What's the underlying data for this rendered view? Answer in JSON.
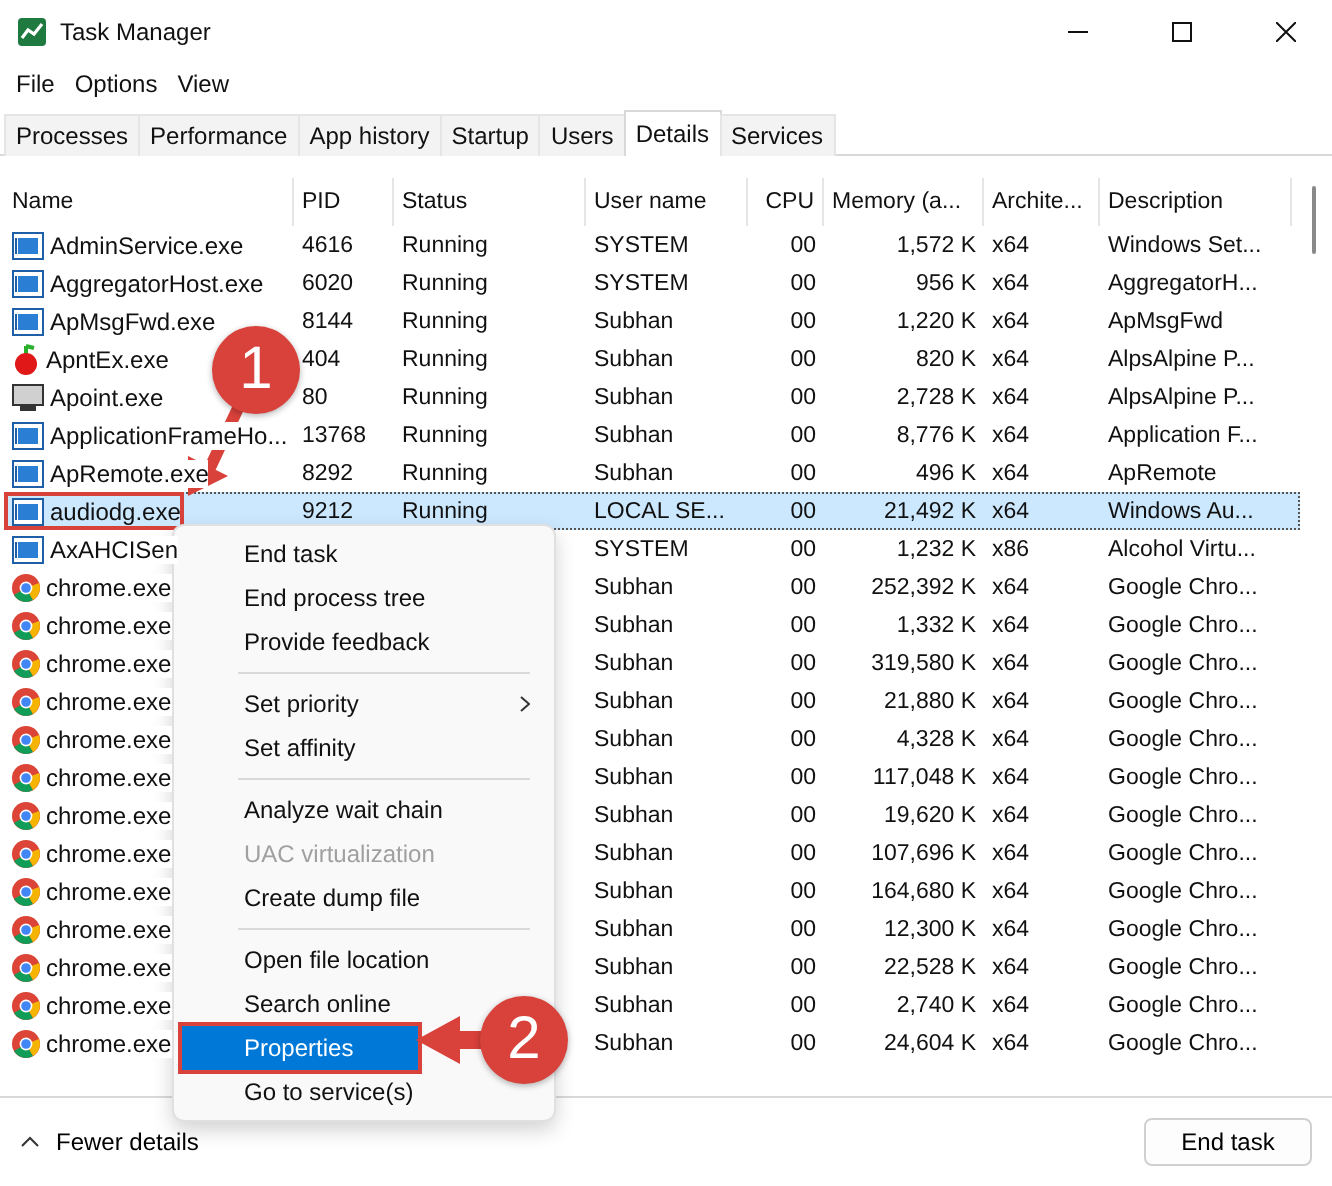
{
  "window": {
    "title": "Task Manager"
  },
  "menu": [
    "File",
    "Options",
    "View"
  ],
  "tabs": [
    {
      "label": "Processes",
      "selected": false
    },
    {
      "label": "Performance",
      "selected": false
    },
    {
      "label": "App history",
      "selected": false
    },
    {
      "label": "Startup",
      "selected": false
    },
    {
      "label": "Users",
      "selected": false
    },
    {
      "label": "Details",
      "selected": true
    },
    {
      "label": "Services",
      "selected": false
    }
  ],
  "columns": [
    "Name",
    "PID",
    "Status",
    "User name",
    "CPU",
    "Memory (a...",
    "Archite...",
    "Description"
  ],
  "rows": [
    {
      "kind": "exe",
      "name": "AdminService.exe",
      "pid": "4616",
      "status": "Running",
      "user": "SYSTEM",
      "cpu": "00",
      "memory": "1,572 K",
      "arch": "x64",
      "description": "Windows Set...",
      "selected": false
    },
    {
      "kind": "exe",
      "name": "AggregatorHost.exe",
      "pid": "6020",
      "status": "Running",
      "user": "SYSTEM",
      "cpu": "00",
      "memory": "956 K",
      "arch": "x64",
      "description": "AggregatorH...",
      "selected": false
    },
    {
      "kind": "exe",
      "name": "ApMsgFwd.exe",
      "pid": "8144",
      "status": "Running",
      "user": "Subhan",
      "cpu": "00",
      "memory": "1,220 K",
      "arch": "x64",
      "description": "ApMsgFwd",
      "selected": false
    },
    {
      "kind": "cherry",
      "name": "ApntEx.exe",
      "pid": "404",
      "status": "Running",
      "user": "Subhan",
      "cpu": "00",
      "memory": "820 K",
      "arch": "x64",
      "description": "AlpsAlpine P...",
      "selected": false
    },
    {
      "kind": "monitor",
      "name": "Apoint.exe",
      "pid": "80",
      "status": "Running",
      "user": "Subhan",
      "cpu": "00",
      "memory": "2,728 K",
      "arch": "x64",
      "description": "AlpsAlpine P...",
      "selected": false
    },
    {
      "kind": "exe",
      "name": "ApplicationFrameHo...",
      "pid": "13768",
      "status": "Running",
      "user": "Subhan",
      "cpu": "00",
      "memory": "8,776 K",
      "arch": "x64",
      "description": "Application F...",
      "selected": false
    },
    {
      "kind": "exe",
      "name": "ApRemote.exe",
      "pid": "8292",
      "status": "Running",
      "user": "Subhan",
      "cpu": "00",
      "memory": "496 K",
      "arch": "x64",
      "description": "ApRemote",
      "selected": false
    },
    {
      "kind": "exe",
      "name": "audiodg.exe",
      "pid": "9212",
      "status": "Running",
      "user": "LOCAL SE...",
      "cpu": "00",
      "memory": "21,492 K",
      "arch": "x64",
      "description": "Windows Au...",
      "selected": true
    },
    {
      "kind": "exe",
      "name": "AxAHCISen",
      "user": "SYSTEM",
      "cpu": "00",
      "memory": "1,232 K",
      "arch": "x86",
      "description": "Alcohol Virtu...",
      "selected": false
    },
    {
      "kind": "chrome",
      "name": "chrome.exe",
      "user": "Subhan",
      "cpu": "00",
      "memory": "252,392 K",
      "arch": "x64",
      "description": "Google Chro...",
      "selected": false
    },
    {
      "kind": "chrome",
      "name": "chrome.exe",
      "user": "Subhan",
      "cpu": "00",
      "memory": "1,332 K",
      "arch": "x64",
      "description": "Google Chro...",
      "selected": false
    },
    {
      "kind": "chrome",
      "name": "chrome.exe",
      "user": "Subhan",
      "cpu": "00",
      "memory": "319,580 K",
      "arch": "x64",
      "description": "Google Chro...",
      "selected": false
    },
    {
      "kind": "chrome",
      "name": "chrome.exe",
      "user": "Subhan",
      "cpu": "00",
      "memory": "21,880 K",
      "arch": "x64",
      "description": "Google Chro...",
      "selected": false
    },
    {
      "kind": "chrome",
      "name": "chrome.exe",
      "user": "Subhan",
      "cpu": "00",
      "memory": "4,328 K",
      "arch": "x64",
      "description": "Google Chro...",
      "selected": false
    },
    {
      "kind": "chrome",
      "name": "chrome.exe",
      "user": "Subhan",
      "cpu": "00",
      "memory": "117,048 K",
      "arch": "x64",
      "description": "Google Chro...",
      "selected": false
    },
    {
      "kind": "chrome",
      "name": "chrome.exe",
      "user": "Subhan",
      "cpu": "00",
      "memory": "19,620 K",
      "arch": "x64",
      "description": "Google Chro...",
      "selected": false
    },
    {
      "kind": "chrome",
      "name": "chrome.exe",
      "user": "Subhan",
      "cpu": "00",
      "memory": "107,696 K",
      "arch": "x64",
      "description": "Google Chro...",
      "selected": false
    },
    {
      "kind": "chrome",
      "name": "chrome.exe",
      "user": "Subhan",
      "cpu": "00",
      "memory": "164,680 K",
      "arch": "x64",
      "description": "Google Chro...",
      "selected": false
    },
    {
      "kind": "chrome",
      "name": "chrome.exe",
      "user": "Subhan",
      "cpu": "00",
      "memory": "12,300 K",
      "arch": "x64",
      "description": "Google Chro...",
      "selected": false
    },
    {
      "kind": "chrome",
      "name": "chrome.exe",
      "user": "Subhan",
      "cpu": "00",
      "memory": "22,528 K",
      "arch": "x64",
      "description": "Google Chro...",
      "selected": false
    },
    {
      "kind": "chrome",
      "name": "chrome.exe",
      "user": "Subhan",
      "cpu": "00",
      "memory": "2,740 K",
      "arch": "x64",
      "description": "Google Chro...",
      "selected": false
    },
    {
      "kind": "chrome",
      "name": "chrome.exe",
      "user": "Subhan",
      "cpu": "00",
      "memory": "24,604 K",
      "arch": "x64",
      "description": "Google Chro...",
      "selected": false
    }
  ],
  "context_menu": [
    {
      "kind": "item",
      "label": "End task",
      "disabled": false,
      "selected": false
    },
    {
      "kind": "item",
      "label": "End process tree",
      "disabled": false,
      "selected": false
    },
    {
      "kind": "item",
      "label": "Provide feedback",
      "disabled": false,
      "selected": false
    },
    {
      "kind": "separator"
    },
    {
      "kind": "submenu",
      "label": "Set priority",
      "disabled": false,
      "selected": false
    },
    {
      "kind": "item",
      "label": "Set affinity",
      "disabled": false,
      "selected": false
    },
    {
      "kind": "separator"
    },
    {
      "kind": "item",
      "label": "Analyze wait chain",
      "disabled": false,
      "selected": false
    },
    {
      "kind": "item",
      "label": "UAC virtualization",
      "disabled": true,
      "selected": false
    },
    {
      "kind": "item",
      "label": "Create dump file",
      "disabled": false,
      "selected": false
    },
    {
      "kind": "separator"
    },
    {
      "kind": "item",
      "label": "Open file location",
      "disabled": false,
      "selected": false
    },
    {
      "kind": "item",
      "label": "Search online",
      "disabled": false,
      "selected": false
    },
    {
      "kind": "item",
      "label": "Properties",
      "disabled": false,
      "selected": true
    },
    {
      "kind": "item",
      "label": "Go to service(s)",
      "disabled": false,
      "selected": false
    }
  ],
  "annotations": [
    "1",
    "2"
  ],
  "footer": {
    "toggle": "Fewer details",
    "button": "End task"
  }
}
